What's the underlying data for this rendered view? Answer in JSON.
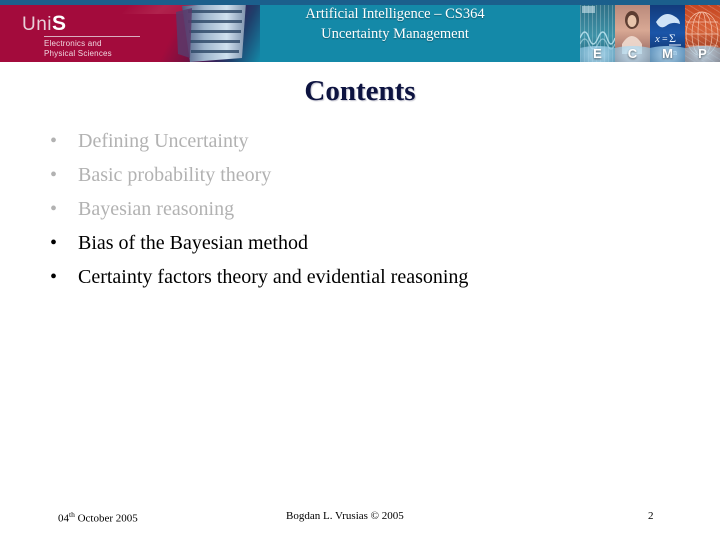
{
  "header": {
    "course_title": "Artificial Intelligence – CS364",
    "lecture_title": "Uncertainty Management",
    "logo": {
      "name_prefix": "Uni",
      "name_suffix": "S",
      "department_line1": "Electronics and",
      "department_line2": "Physical Sciences"
    },
    "strip": [
      {
        "glyph": "E",
        "icon": "signal-waveform-icon"
      },
      {
        "glyph": "C",
        "icon": "person-photo-icon"
      },
      {
        "glyph": "M",
        "icon": "dolphin-equation-icon"
      },
      {
        "glyph": "P",
        "icon": "radar-grid-icon"
      }
    ],
    "colors": {
      "crimson": "#a30b3c",
      "teal": "#1489a8",
      "top_strip": "#1b5f8c"
    }
  },
  "slide": {
    "title": "Contents",
    "title_color": "#0d1340",
    "bullet_marker": "•",
    "bullets": [
      {
        "text": "Defining Uncertainty",
        "state": "dim"
      },
      {
        "text": "Basic probability theory",
        "state": "dim"
      },
      {
        "text": "Bayesian reasoning",
        "state": "dim"
      },
      {
        "text": "Bias of the Bayesian method",
        "state": "on"
      },
      {
        "text": "Certainty factors theory and evidential reasoning",
        "state": "on"
      }
    ]
  },
  "footer": {
    "date_number": "04",
    "date_ordinal": "th",
    "date_rest": " October 2005",
    "author": "Bogdan L. Vrusias © 2005",
    "page_number": "2"
  }
}
